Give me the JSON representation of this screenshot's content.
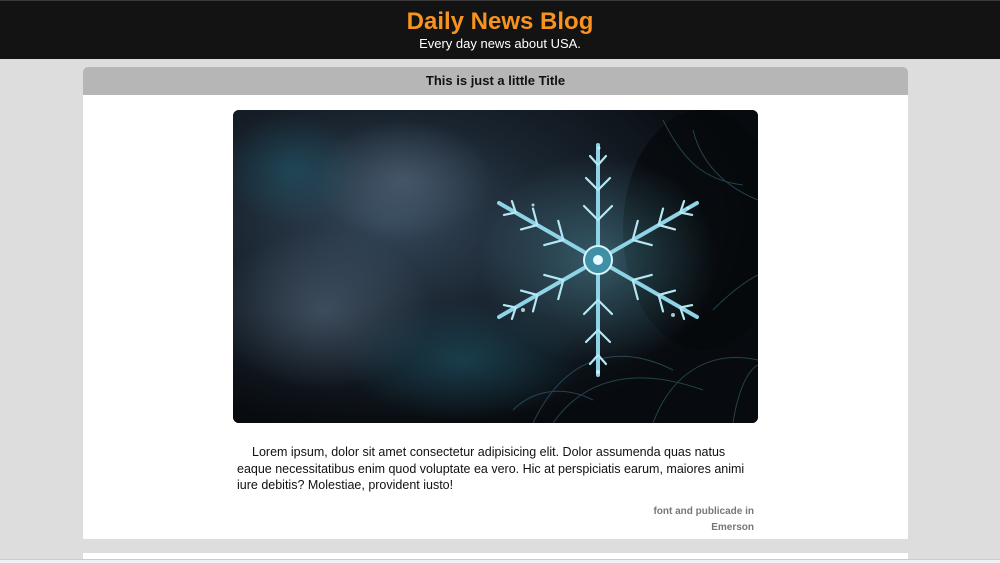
{
  "header": {
    "title": "Daily News Blog",
    "subtitle": "Every day news about USA."
  },
  "post": {
    "title": "This is just a little Title",
    "image_description": "snowflake-photo",
    "body": "Lorem ipsum, dolor sit amet consectetur adipisicing elit. Dolor assumenda quas natus eaque necessitatibus enim quod voluptate ea vero. Hic at perspiciatis earum, maiores animi iure debitis? Molestiae, provident iusto!",
    "meta_line1": "font and publicade in",
    "meta_line2": "Emerson"
  },
  "colors": {
    "header_bg": "#131313",
    "title_orange": "#f7931e",
    "page_bg": "#dddddd",
    "title_bar": "#b6b6b6"
  }
}
